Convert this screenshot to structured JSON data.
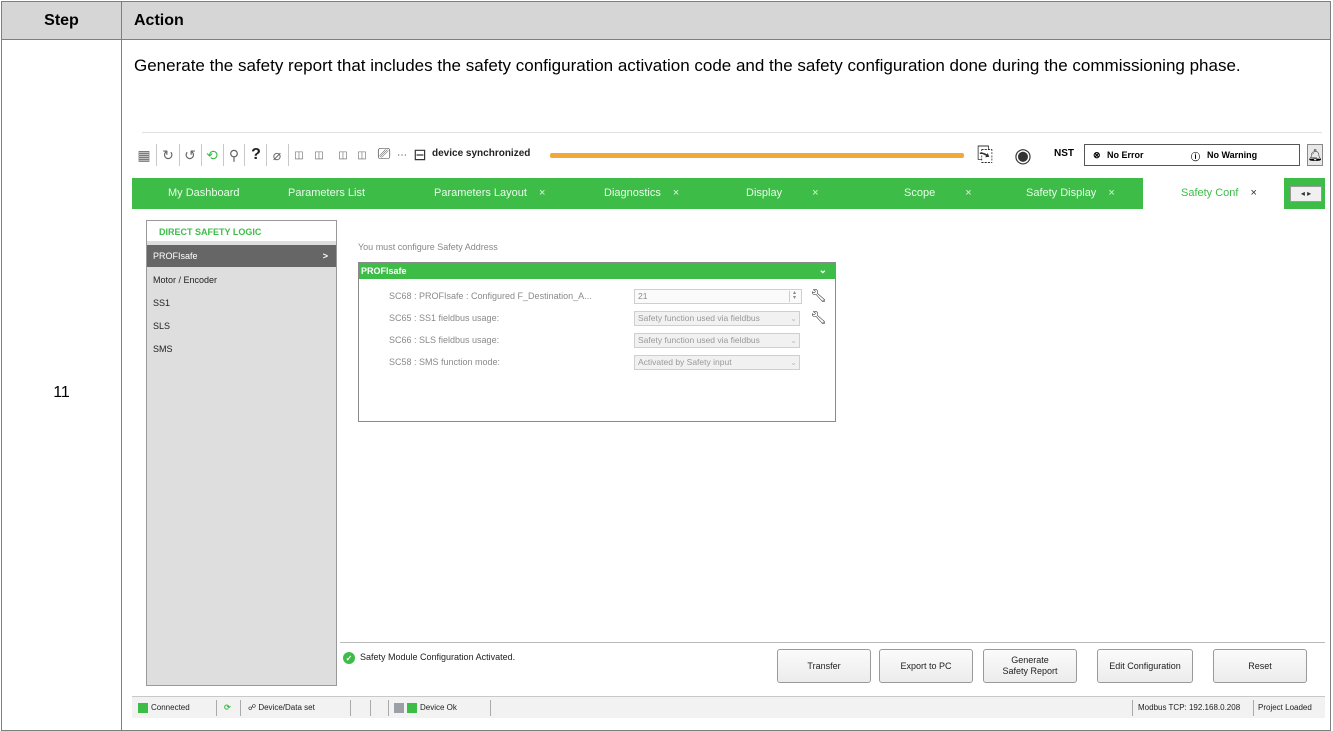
{
  "table": {
    "header_step": "Step",
    "header_action": "Action",
    "step_number": "11",
    "instruction": "Generate the safety report that includes the safety configuration activation code and the safety configuration done during the commissioning phase."
  },
  "toolbar": {
    "sync_status": "device synchronized",
    "nst_label": "NST",
    "no_error": "No Error",
    "no_warning": "No Warning"
  },
  "tabs": [
    {
      "label": "My Dashboard",
      "closable": false
    },
    {
      "label": "Parameters List",
      "closable": false
    },
    {
      "label": "Parameters Layout",
      "closable": true
    },
    {
      "label": "Diagnostics",
      "closable": true
    },
    {
      "label": "Display",
      "closable": true
    },
    {
      "label": "Scope",
      "closable": true
    },
    {
      "label": "Safety Display",
      "closable": true
    },
    {
      "label": "Safety Conf",
      "closable": true,
      "active": true
    }
  ],
  "tab_close_glyph": "×",
  "nav": {
    "title": "DIRECT SAFETY LOGIC",
    "items": [
      "PROFIsafe",
      "Motor / Encoder",
      "SS1",
      "SLS",
      "SMS"
    ],
    "selected_chevron": ">"
  },
  "content": {
    "hint": "You must configure Safety Address",
    "panel_title": "PROFIsafe",
    "params": [
      {
        "label": "SC68 : PROFIsafe : Configured F_Destination_A...",
        "value": "21"
      },
      {
        "label": "SC65 : SS1 fieldbus usage:",
        "value": "Safety function used via fieldbus"
      },
      {
        "label": "SC66 : SLS fieldbus usage:",
        "value": "Safety function used via fieldbus"
      },
      {
        "label": "SC58 : SMS function mode:",
        "value": "Activated by Safety input"
      }
    ]
  },
  "bottom": {
    "status_message": "Safety Module Configuration Activated.",
    "buttons": {
      "transfer": "Transfer",
      "export": "Export to PC",
      "generate_line1": "Generate",
      "generate_line2": "Safety Report",
      "edit": "Edit Configuration",
      "reset": "Reset"
    }
  },
  "statusbar": {
    "connected": "Connected",
    "device_data_set": "Device/Data set",
    "device_ok": "Device Ok",
    "modbus": "Modbus TCP: 192.168.0.208",
    "project": "Project Loaded"
  },
  "colors": {
    "accent_green": "#3dbd48",
    "sync_bar": "#f1a93a",
    "header_gray": "#d6d6d6"
  }
}
